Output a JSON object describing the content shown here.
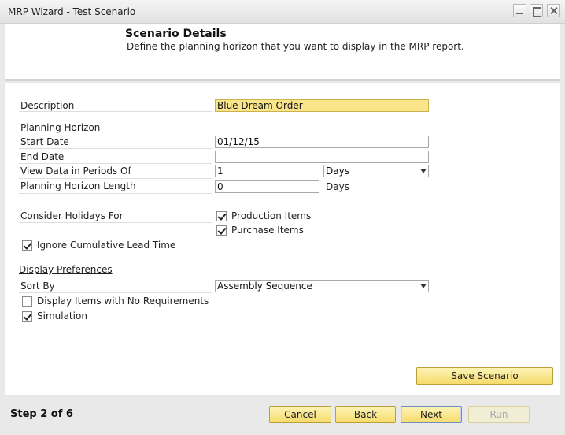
{
  "window": {
    "title": "MRP Wizard - Test Scenario"
  },
  "header": {
    "title": "Scenario Details",
    "subtitle": "Define the planning horizon that you want to display in the MRP report."
  },
  "form": {
    "description_label": "Description",
    "description_value": "Blue Dream Order",
    "planning_horizon_label": "Planning Horizon",
    "start_date_label": "Start Date",
    "start_date_value": "01/12/15",
    "end_date_label": "End Date",
    "end_date_value": "",
    "view_periods_label": "View Data in Periods Of",
    "view_periods_value": "1",
    "view_periods_unit": "Days",
    "horizon_length_label": "Planning Horizon Length",
    "horizon_length_value": "0",
    "horizon_length_unit": "Days",
    "holidays_label": "Consider Holidays For",
    "production_items_label": "Production Items",
    "production_items_checked": true,
    "purchase_items_label": "Purchase Items",
    "purchase_items_checked": true,
    "ignore_lead_time_label": "Ignore Cumulative Lead Time",
    "ignore_lead_time_checked": true,
    "display_prefs_label": "Display Preferences",
    "sort_by_label": "Sort By",
    "sort_by_value": "Assembly Sequence",
    "display_no_req_label": "Display Items with No Requirements",
    "display_no_req_checked": false,
    "simulation_label": "Simulation",
    "simulation_checked": true
  },
  "buttons": {
    "save_scenario": "Save Scenario",
    "cancel": "Cancel",
    "back": "Back",
    "next": "Next",
    "run": "Run"
  },
  "footer": {
    "step": "Step 2 of 6"
  },
  "colors": {
    "accent": "#f6dc6c",
    "active_field": "#fbe58a"
  }
}
